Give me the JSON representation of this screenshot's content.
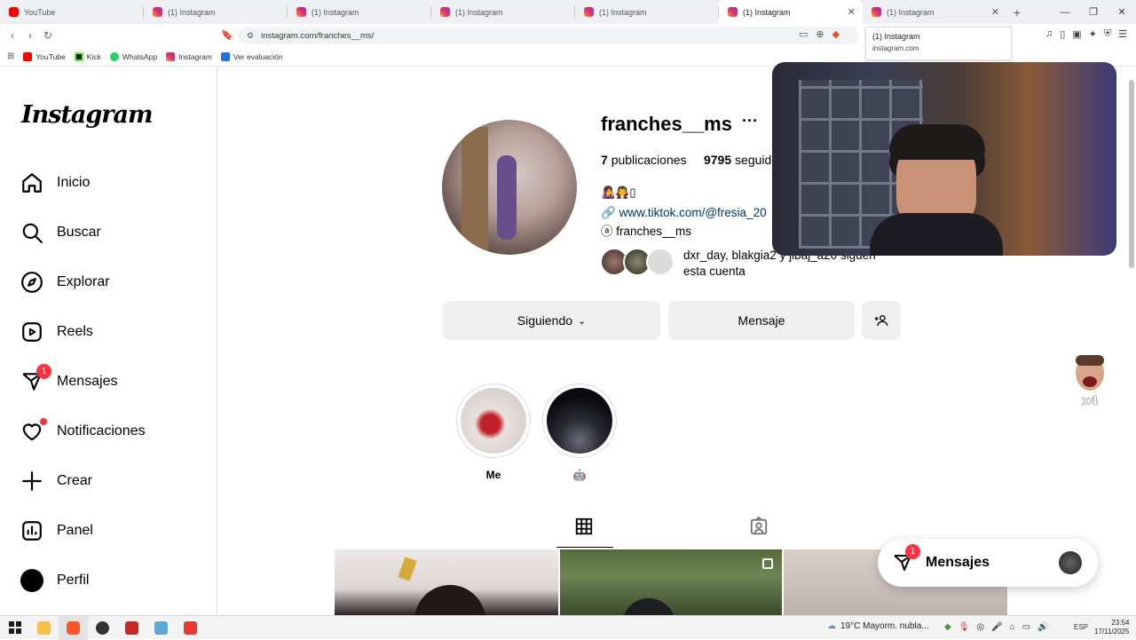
{
  "browser": {
    "tabs": [
      {
        "title": "YouTube",
        "icon": "youtube-icon"
      },
      {
        "title": "(1) Instagram",
        "icon": "instagram-icon"
      },
      {
        "title": "(1) Instagram",
        "icon": "instagram-icon"
      },
      {
        "title": "(1) Instagram",
        "icon": "instagram-icon"
      },
      {
        "title": "(1) Instagram",
        "icon": "instagram-icon"
      },
      {
        "title": "(1) Instagram",
        "icon": "instagram-icon",
        "active": true
      },
      {
        "title": "(1) Instagram",
        "icon": "instagram-icon"
      }
    ],
    "url": "instagram.com/franches__ms/",
    "bookmarks": [
      {
        "label": "YouTube",
        "color": "#ff0000"
      },
      {
        "label": "Kick",
        "color": "#0f0f0f"
      },
      {
        "label": "WhatsApp",
        "color": "#25d366"
      },
      {
        "label": "Instagram",
        "color": "#e1306c"
      },
      {
        "label": "Ver evaluación",
        "color": "#1a73e8"
      }
    ],
    "tooltip": {
      "title": "(1) Instagram",
      "domain": "instagram.com"
    }
  },
  "sidebar": {
    "logo": "Instagram",
    "items": [
      {
        "label": "Inicio",
        "icon": "home-icon"
      },
      {
        "label": "Buscar",
        "icon": "search-icon"
      },
      {
        "label": "Explorar",
        "icon": "compass-icon"
      },
      {
        "label": "Reels",
        "icon": "reels-icon"
      },
      {
        "label": "Mensajes",
        "icon": "messenger-icon",
        "badge": "1"
      },
      {
        "label": "Notificaciones",
        "icon": "heart-icon"
      },
      {
        "label": "Crear",
        "icon": "plus-icon"
      },
      {
        "label": "Panel",
        "icon": "chart-icon"
      },
      {
        "label": "Perfil",
        "icon": "profile-avatar"
      }
    ]
  },
  "profile": {
    "username": "franches__ms",
    "posts_count": "7",
    "posts_label": "publicaciones",
    "followers_count": "9795",
    "followers_label": "seguido",
    "bio_emoji": "👩‍🎤🧛▯",
    "link": "www.tiktok.com/@fresia_20",
    "threads_handle": "franches__ms",
    "followed_by_text": "dxr_day, blakgia2 y jibaj_a20 siguen esta cuenta",
    "following_button": "Siguiendo",
    "message_button": "Mensaje"
  },
  "highlights": [
    {
      "label": "Me"
    },
    {
      "label": "🤖"
    }
  ],
  "messages_pill": {
    "label": "Mensajes",
    "badge": "1"
  },
  "taskbar": {
    "weather": "19°C  Mayorm. nubla...",
    "lang": "ESP",
    "time": "23:54",
    "date": "17/11/2025"
  },
  "colors": {
    "accent_blue": "#0095f6",
    "badge_red": "#ff3040",
    "link_blue": "#00376b"
  }
}
